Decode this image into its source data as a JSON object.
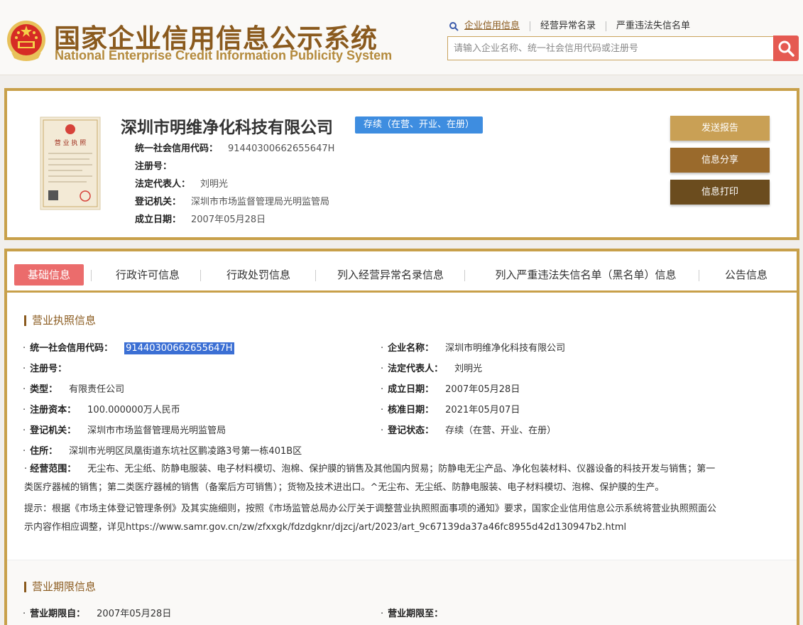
{
  "header": {
    "title_cn": "国家企业信用信息公示系统",
    "title_en": "National Enterprise Credit Information Publicity System",
    "links": [
      "企业信用信息",
      "经营异常名录",
      "严重违法失信名单"
    ],
    "search_placeholder": "请输入企业名称、统一社会信用代码或注册号"
  },
  "company": {
    "name": "深圳市明维净化科技有限公司",
    "status": "存续（在营、开业、在册）",
    "fields": [
      {
        "label": "统一社会信用代码：",
        "value": "91440300662655647H"
      },
      {
        "label": "注册号：",
        "value": ""
      },
      {
        "label": "法定代表人：",
        "value": "刘明光"
      },
      {
        "label": "登记机关：",
        "value": "深圳市市场监督管理局光明监管局"
      },
      {
        "label": "成立日期：",
        "value": "2007年05月28日"
      }
    ],
    "license_text": "营业执照"
  },
  "actions": {
    "send_report": "发送报告",
    "share": "信息分享",
    "print": "信息打印"
  },
  "tabs": [
    "基础信息",
    "行政许可信息",
    "行政处罚信息",
    "列入经营异常名录信息",
    "列入严重违法失信名单（黑名单）信息",
    "公告信息"
  ],
  "license_info": {
    "title": "营业执照信息",
    "left": [
      {
        "label": "统一社会信用代码：",
        "value": "91440300662655647H"
      },
      {
        "label": "注册号：",
        "value": ""
      },
      {
        "label": "类型：",
        "value": "有限责任公司"
      },
      {
        "label": "注册资本：",
        "value": "100.000000万人民币"
      },
      {
        "label": "登记机关：",
        "value": "深圳市市场监督管理局光明监管局"
      },
      {
        "label": "住所：",
        "value": "深圳市光明区凤凰街道东坑社区鹏凌路3号第一栋401B区"
      }
    ],
    "right": [
      {
        "label": "企业名称：",
        "value": "深圳市明维净化科技有限公司"
      },
      {
        "label": "法定代表人：",
        "value": "刘明光"
      },
      {
        "label": "成立日期：",
        "value": "2007年05月28日"
      },
      {
        "label": "核准日期：",
        "value": "2021年05月07日"
      },
      {
        "label": "登记状态：",
        "value": "存续（在营、开业、在册）"
      }
    ],
    "scope_label": "经营范围：",
    "scope_line1": "无尘布、无尘纸、防静电服装、电子材料模切、泡棉、保护膜的销售及其他国内贸易；防静电无尘产品、净化包装材料、仪器设备的科技开发与销售；第一",
    "scope_line2": "类医疗器械的销售；第二类医疗器械的销售（备案后方可销售）；货物及技术进出口。^无尘布、无尘纸、防静电服装、电子材料模切、泡棉、保护膜的生产。",
    "notice_line1": "提示：根据《市场主体登记管理条例》及其实施细则，按照《市场监管总局办公厅关于调整营业执照照面事项的通知》要求，国家企业信用信息公示系统将营业执照照面公",
    "notice_line2": "示内容作相应调整，详见https://www.samr.gov.cn/zw/zfxxgk/fdzdgknr/djzcj/art/2023/art_9c67139da37a46fc8955d42d130947b2.html"
  },
  "term_info": {
    "title": "营业期限信息",
    "from_label": "营业期限自：",
    "from_value": "2007年05月28日",
    "to_label": "营业期限至：",
    "to_value": ""
  },
  "colors": {
    "gold_border": "#c8a04a",
    "brand_brown": "#8a5a1e",
    "status_blue": "#3e8de0",
    "tab_active": "#eb6c6c",
    "btn_report": "#c9a055",
    "btn_share": "#9a6a2c",
    "btn_print": "#6b4c1e"
  }
}
